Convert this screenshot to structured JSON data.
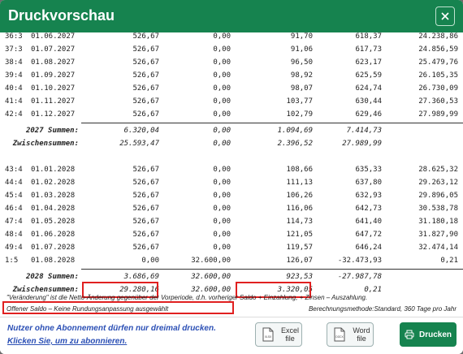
{
  "dialog": {
    "title": "Druckvorschau"
  },
  "rows_a": [
    [
      "36:3",
      "01.06.2027",
      "526,67",
      "0,00",
      "91,70",
      "618,37",
      "24.238,86"
    ],
    [
      "37:3",
      "01.07.2027",
      "526,67",
      "0,00",
      "91,06",
      "617,73",
      "24.856,59"
    ],
    [
      "38:4",
      "01.08.2027",
      "526,67",
      "0,00",
      "96,50",
      "623,17",
      "25.479,76"
    ],
    [
      "39:4",
      "01.09.2027",
      "526,67",
      "0,00",
      "98,92",
      "625,59",
      "26.105,35"
    ],
    [
      "40:4",
      "01.10.2027",
      "526,67",
      "0,00",
      "98,07",
      "624,74",
      "26.730,09"
    ],
    [
      "41:4",
      "01.11.2027",
      "526,67",
      "0,00",
      "103,77",
      "630,44",
      "27.360,53"
    ],
    [
      "42:4",
      "01.12.2027",
      "526,67",
      "0,00",
      "102,79",
      "629,46",
      "27.989,99"
    ]
  ],
  "sum_2027": {
    "label": "2027 Summen:",
    "values": [
      "6.320,04",
      "0,00",
      "1.094,69",
      "7.414,73"
    ]
  },
  "zw_2027": {
    "label": "Zwischensummen:",
    "values": [
      "25.593,47",
      "0,00",
      "2.396,52",
      "27.989,99"
    ]
  },
  "rows_b": [
    [
      "43:4",
      "01.01.2028",
      "526,67",
      "0,00",
      "108,66",
      "635,33",
      "28.625,32"
    ],
    [
      "44:4",
      "01.02.2028",
      "526,67",
      "0,00",
      "111,13",
      "637,80",
      "29.263,12"
    ],
    [
      "45:4",
      "01.03.2028",
      "526,67",
      "0,00",
      "106,26",
      "632,93",
      "29.896,05"
    ],
    [
      "46:4",
      "01.04.2028",
      "526,67",
      "0,00",
      "116,06",
      "642,73",
      "30.538,78"
    ],
    [
      "47:4",
      "01.05.2028",
      "526,67",
      "0,00",
      "114,73",
      "641,40",
      "31.180,18"
    ],
    [
      "48:4",
      "01.06.2028",
      "526,67",
      "0,00",
      "121,05",
      "647,72",
      "31.827,90"
    ],
    [
      "49:4",
      "01.07.2028",
      "526,67",
      "0,00",
      "119,57",
      "646,24",
      "32.474,14"
    ],
    [
      "1:5",
      "01.08.2028",
      "0,00",
      "32.600,00",
      "126,07",
      "-32.473,93",
      "0,21"
    ]
  ],
  "sum_2028": {
    "label": "2028 Summen:",
    "values": [
      "3.686,69",
      "32.600,00",
      "923,53",
      "-27.987,78"
    ]
  },
  "zw_2028": {
    "label": "Zwischensummen:",
    "values": [
      "29.280,16",
      "32.600,00",
      "3.320,05",
      "0,21"
    ]
  },
  "notes": {
    "footnote": "\"Veränderung\" ist die Netto-Änderung gegenüber der Vorperiode, d.h. vorheriger Saldo + Einzahlung, + Zinsen – Auszahlung.",
    "status": "Offener Saldo – Keine Rundungsanpassung ausgewählt",
    "method": "Berechnungsmethode:Standard, 360 Tage pro Jahr"
  },
  "footer": {
    "notice": "Nutzer ohne Abonnement dürfen nur dreimal drucken.",
    "subscribe_link": "Klicken Sie, um zu abonnieren.",
    "excel_label_1": "Excel",
    "excel_label_2": "file",
    "excel_icon_text": "XLSX",
    "word_label_1": "Word",
    "word_label_2": "file",
    "word_icon_text": "DOCX",
    "print_label": "Drucken"
  },
  "colors": {
    "accent": "#16834f",
    "highlight": "#e02020",
    "link": "#2b4fb5"
  },
  "icons": [
    "close-icon",
    "excel-file-icon",
    "word-file-icon",
    "printer-icon"
  ]
}
